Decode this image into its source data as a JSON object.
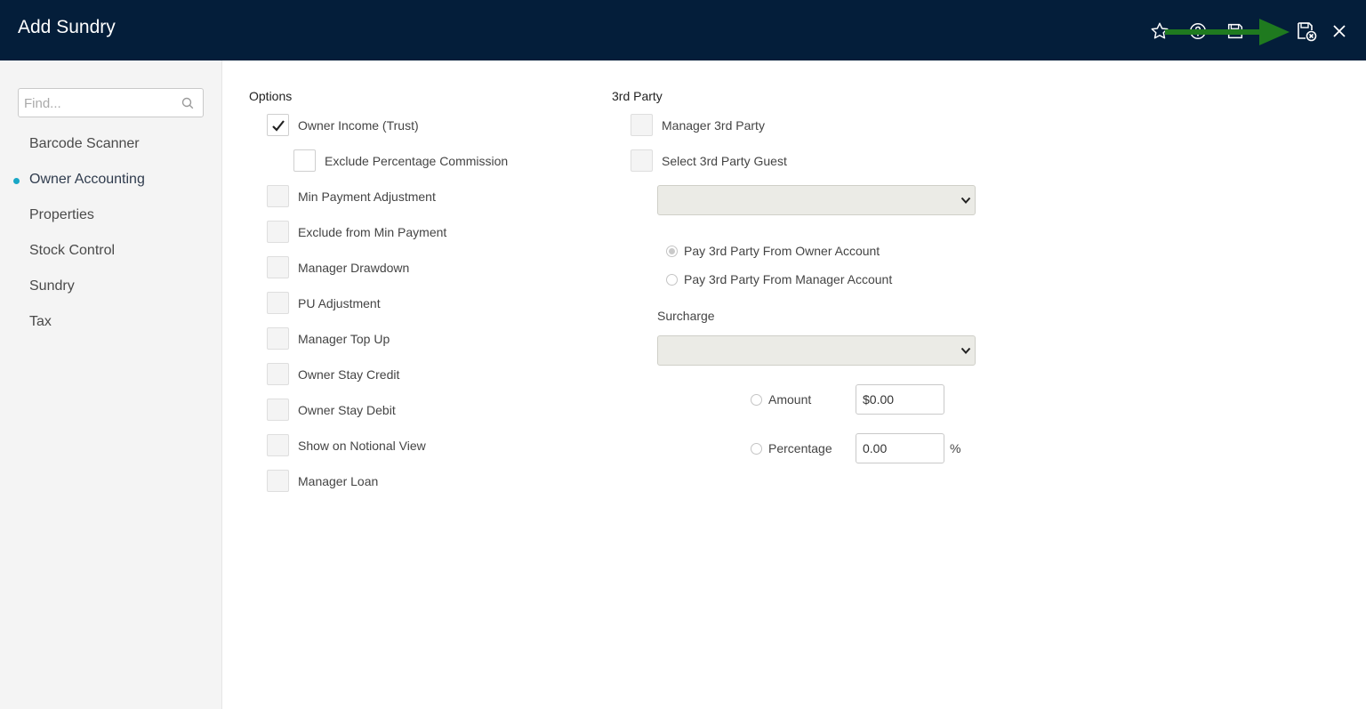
{
  "header": {
    "title": "Add Sundry",
    "icons": [
      "star-icon",
      "help-icon",
      "save-icon",
      "save-and-close-icon",
      "close-icon"
    ],
    "background": "#041e3a"
  },
  "sidebar": {
    "search_placeholder": "Find...",
    "items": [
      {
        "label": "Barcode Scanner",
        "active": false
      },
      {
        "label": "Owner Accounting",
        "active": true
      },
      {
        "label": "Properties",
        "active": false
      },
      {
        "label": "Stock Control",
        "active": false
      },
      {
        "label": "Sundry",
        "active": false
      },
      {
        "label": "Tax",
        "active": false
      }
    ],
    "active_color": "#19a7c6"
  },
  "options": {
    "title": "Options",
    "items": [
      {
        "label": "Owner Income (Trust)",
        "checked": true
      },
      {
        "label": "Exclude Percentage Commission",
        "checked": false
      },
      {
        "label": "Min Payment Adjustment",
        "checked": false
      },
      {
        "label": "Exclude from Min Payment",
        "checked": false
      },
      {
        "label": "Manager Drawdown",
        "checked": false
      },
      {
        "label": "PU Adjustment",
        "checked": false
      },
      {
        "label": "Manager Top Up",
        "checked": false
      },
      {
        "label": "Owner Stay Credit",
        "checked": false
      },
      {
        "label": "Owner Stay Debit",
        "checked": false
      },
      {
        "label": "Show on Notional View",
        "checked": false
      },
      {
        "label": "Manager Loan",
        "checked": false
      }
    ]
  },
  "third_party": {
    "title": "3rd Party",
    "manager_3rd_party": "Manager 3rd Party",
    "select_guest": "Select 3rd Party Guest",
    "guest_select_value": "",
    "pay_from_owner": "Pay 3rd Party From Owner Account",
    "pay_from_manager": "Pay 3rd Party From Manager Account",
    "pay_selected": "owner"
  },
  "surcharge": {
    "label": "Surcharge",
    "select_value": "",
    "amount_label": "Amount",
    "amount_value": "$0.00",
    "percentage_label": "Percentage",
    "percentage_value": "0.00",
    "percent_suffix": "%"
  },
  "annotation": {
    "arrow_color": "#1f7a1f",
    "points_to": "save-and-close-icon"
  }
}
